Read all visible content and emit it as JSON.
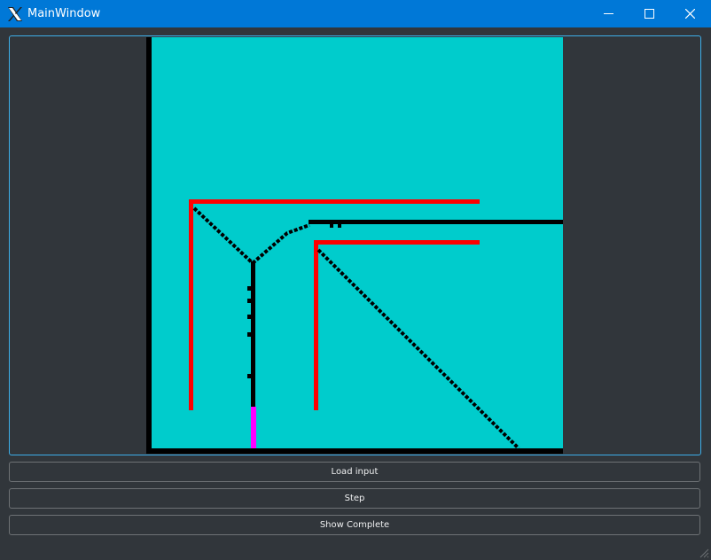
{
  "window": {
    "title": "MainWindow",
    "icon": "x-logo-icon"
  },
  "window_controls": {
    "minimize": "minimize-icon",
    "maximize": "maximize-icon",
    "close": "close-icon"
  },
  "buttons": {
    "load_input": "Load input",
    "step": "Step",
    "show_complete": "Show Complete"
  },
  "colors": {
    "titlebar": "#0078d7",
    "background": "#31363b",
    "focus_border": "#3daee9",
    "canvas_fill": "#00cccc",
    "wall": "#ff0000",
    "path": "#000000",
    "source": "#ff00ff"
  }
}
